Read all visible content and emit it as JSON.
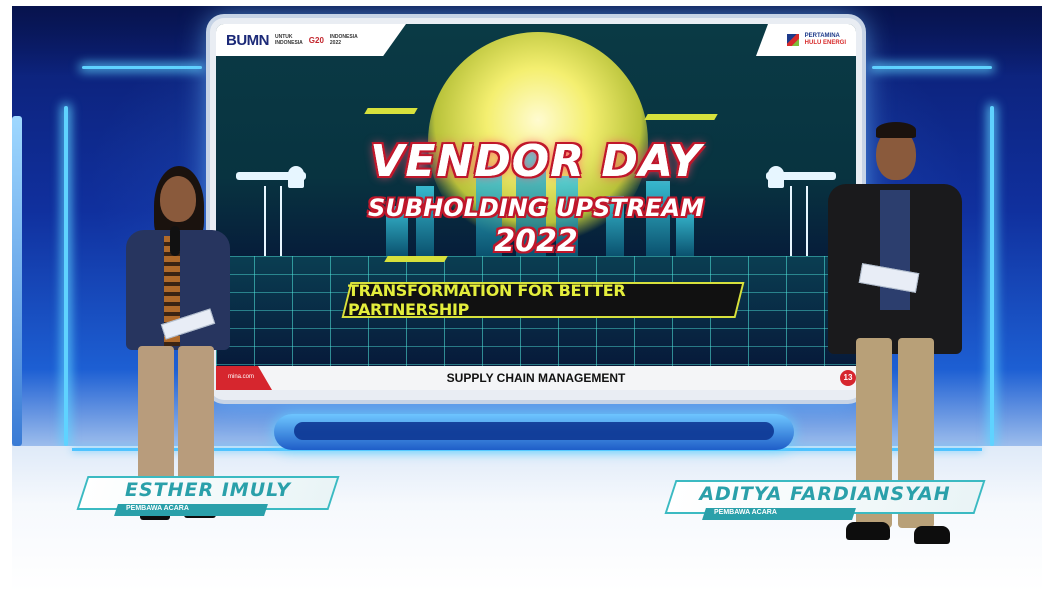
{
  "screen": {
    "logos": {
      "bumn": "BUMN",
      "bumn_tag_1": "UNTUK",
      "bumn_tag_2": "INDONESIA",
      "g20": "G20",
      "g20_tag_1": "INDONESIA",
      "g20_tag_2": "2022",
      "pertamina": "PERTAMINA",
      "pertamina_sub": "HULU ENERGI"
    },
    "title_line1": "VENDOR DAY",
    "title_line2": "SUBHOLDING UPSTREAM",
    "title_line3": "2022",
    "tagline": "TRANSFORMATION FOR BETTER PARTNERSHIP",
    "footer_url": "mina.com",
    "footer_text": "SUPPLY CHAIN MANAGEMENT",
    "footer_badge": "13"
  },
  "host_left": {
    "name": "ESTHER IMULY",
    "role": "PEMBAWA ACARA"
  },
  "host_right": {
    "name": "ADITYA FARDIANSYAH",
    "role": "PEMBAWA ACARA"
  },
  "colors": {
    "studio_blue": "#10309e",
    "neon": "#5fd3ff",
    "title_red": "#c0172b",
    "tagline_yellow": "#e4ee3c",
    "nameplate_teal": "#2aa0aa"
  }
}
